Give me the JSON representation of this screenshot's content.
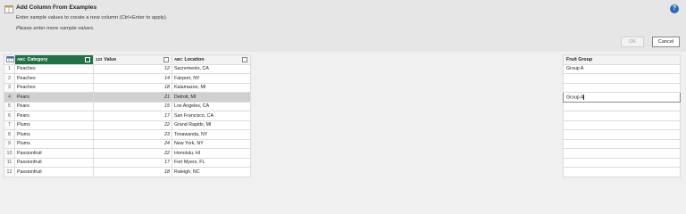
{
  "dialog": {
    "title": "Add Column From Examples",
    "description": "Enter sample values to create a new column (Ctrl+Enter to apply).",
    "warning": "Please enter more sample values.",
    "ok_label": "OK",
    "cancel_label": "Cancel",
    "help_label": "?"
  },
  "icons": {
    "title": "add-column-icon",
    "help": "help-icon",
    "table_menu": "table-grid-icon"
  },
  "colors": {
    "selected_header": "#217346",
    "highlight_row": "#d0d0d0",
    "help": "#2b6bb5"
  },
  "table": {
    "columns": [
      {
        "type": "ABC",
        "name": "Category",
        "selected": true
      },
      {
        "type": "123",
        "name": "Value",
        "selected": false
      },
      {
        "type": "ABC",
        "name": "Location",
        "selected": false
      }
    ],
    "rows": [
      {
        "n": "1",
        "category": "Peaches",
        "value": "12",
        "location": "Sacremento, CA"
      },
      {
        "n": "2",
        "category": "Peaches",
        "value": "14",
        "location": "Fairport, NY"
      },
      {
        "n": "3",
        "category": "Peaches",
        "value": "18",
        "location": "Kalamazoo, MI"
      },
      {
        "n": "4",
        "category": "Pears",
        "value": "21",
        "location": "Detroit, MI"
      },
      {
        "n": "5",
        "category": "Pears",
        "value": "15",
        "location": "Los Angeles, CA"
      },
      {
        "n": "6",
        "category": "Pears",
        "value": "17",
        "location": "San Francisco, CA"
      },
      {
        "n": "7",
        "category": "Plums",
        "value": "22",
        "location": "Grand Rapids, MI"
      },
      {
        "n": "8",
        "category": "Plums",
        "value": "23",
        "location": "Tonawanda, NY"
      },
      {
        "n": "9",
        "category": "Plums",
        "value": "24",
        "location": "New York, NY"
      },
      {
        "n": "10",
        "category": "Passionfruit",
        "value": "22",
        "location": "Honolulu, HI"
      },
      {
        "n": "11",
        "category": "Passionfruit",
        "value": "17",
        "location": "Fort Myers, FL"
      },
      {
        "n": "12",
        "category": "Passionfruit",
        "value": "18",
        "location": "Raleigh, NC"
      }
    ]
  },
  "example_column": {
    "header": "Fruit Group",
    "values": [
      "Group A",
      "",
      "",
      "Group A",
      "",
      "",
      "",
      "",
      "",
      "",
      "",
      ""
    ]
  }
}
